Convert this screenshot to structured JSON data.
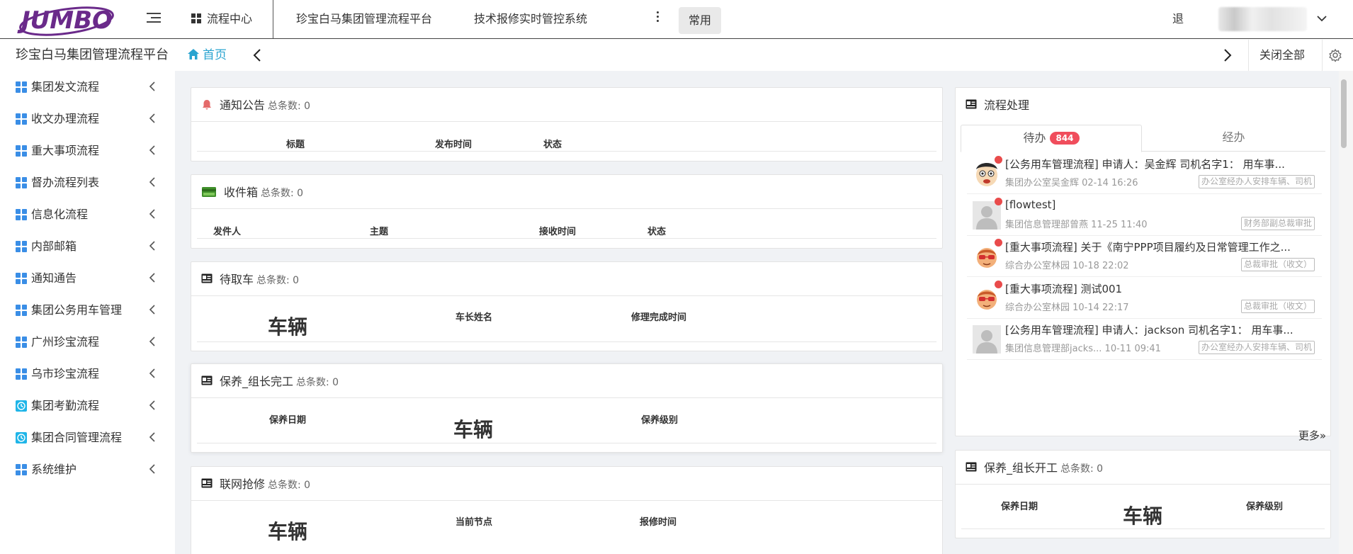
{
  "header": {
    "logo_text": "JUMBO",
    "nav": {
      "flow_center": "流程中心",
      "platform": "珍宝白马集团管理流程平台",
      "repair": "技术报修实时管控系统",
      "common": "常用"
    },
    "logout": "退",
    "colors": {
      "logo": "#6a2a8a",
      "accent": "#2aa4d0",
      "badge": "#f04d5c"
    }
  },
  "subbar": {
    "title": "珍宝白马集团管理流程平台",
    "home_tab": "首页",
    "close_all": "关闭全部"
  },
  "sidebar": {
    "items": [
      {
        "label": "集团发文流程",
        "icon": "grid-icon"
      },
      {
        "label": "收文办理流程",
        "icon": "grid-icon"
      },
      {
        "label": "重大事项流程",
        "icon": "grid-icon"
      },
      {
        "label": "督办流程列表",
        "icon": "grid-icon"
      },
      {
        "label": "信息化流程",
        "icon": "grid-icon"
      },
      {
        "label": "内部邮箱",
        "icon": "grid-icon"
      },
      {
        "label": "通知通告",
        "icon": "grid-icon"
      },
      {
        "label": "集团公务用车管理",
        "icon": "grid-icon"
      },
      {
        "label": "广州珍宝流程",
        "icon": "grid-icon"
      },
      {
        "label": "乌市珍宝流程",
        "icon": "grid-icon"
      },
      {
        "label": "集团考勤流程",
        "icon": "clock-icon"
      },
      {
        "label": "集团合同管理流程",
        "icon": "clock-icon"
      },
      {
        "label": "系统维护",
        "icon": "grid-icon"
      }
    ]
  },
  "panels": {
    "notice": {
      "title": "通知公告",
      "count": "总条数: 0",
      "cols": [
        "标题",
        "发布时间",
        "状态"
      ]
    },
    "inbox": {
      "title": "收件箱",
      "count": "总条数: 0",
      "cols": [
        "发件人",
        "主题",
        "接收时间",
        "状态"
      ]
    },
    "pickup": {
      "title": "待取车",
      "count": "总条数: 0",
      "big": "车辆",
      "cols": [
        "车长姓名",
        "修理完成时间"
      ]
    },
    "maint_done": {
      "title": "保养_组长完工",
      "count": "总条数: 0",
      "big": "车辆",
      "cols": [
        "保养日期",
        "保养级别"
      ]
    },
    "network": {
      "title": "联网抢修",
      "count": "总条数: 0",
      "big": "车辆",
      "cols": [
        "当前节点",
        "报修时间"
      ]
    },
    "maint_start": {
      "title": "保养_组长开工",
      "count": "总条数: 0",
      "big": "车辆",
      "cols": [
        "保养日期",
        "保养级别"
      ]
    }
  },
  "process": {
    "title": "流程处理",
    "tab_todo": "待办",
    "todo_count": "844",
    "tab_done": "经办",
    "more": "更多»",
    "tasks": [
      {
        "title": "[公务用车管理流程] 申请人：吴金辉 司机名字1： 用车事...",
        "sub": "集团办公室吴金辉 02-14 16:26",
        "tag": "办公室经办人安排车辆、司机",
        "avatar": "cartoon-face"
      },
      {
        "title": "[flowtest]",
        "sub": "集团信息管理部曾燕 11-25 11:40",
        "tag": "财务部副总裁审批",
        "avatar": "default-user"
      },
      {
        "title": "[重大事项流程] 关于《南宁PPP项目履约及日常管理工作之...",
        "sub": "综合办公室林园 10-18 22:02",
        "tag": "总裁审批（收文）",
        "avatar": "sunglasses-face"
      },
      {
        "title": "[重大事项流程] 测试001",
        "sub": "综合办公室林园 10-14 22:17",
        "tag": "总裁审批（收文）",
        "avatar": "sunglasses-face"
      },
      {
        "title": "[公务用车管理流程] 申请人：jackson 司机名字1： 用车事...",
        "sub": "集团信息管理部jacks... 10-11 09:41",
        "tag": "办公室经办人安排车辆、司机",
        "avatar": "default-user"
      }
    ]
  }
}
